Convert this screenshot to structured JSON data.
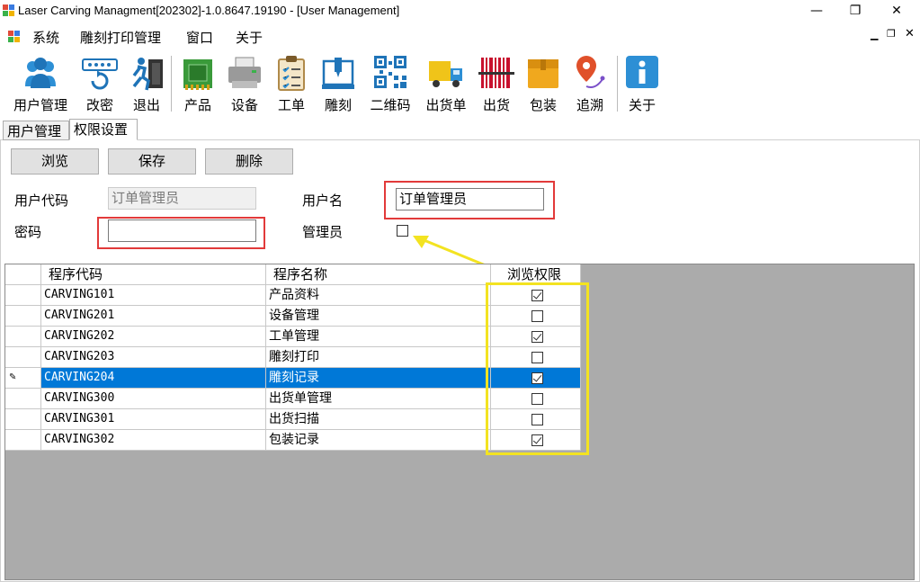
{
  "window": {
    "title": "Laser Carving Managment[202302]-1.0.8647.19190 - [User Management]",
    "minimize": "—",
    "maximize": "❐",
    "close": "✕"
  },
  "menu": {
    "items": [
      "系统",
      "雕刻打印管理",
      "窗口",
      "关于"
    ]
  },
  "toolbar": {
    "buttons": [
      {
        "label": "用户管理",
        "icon": "users-icon"
      },
      {
        "label": "改密",
        "icon": "password-icon"
      },
      {
        "label": "退出",
        "icon": "exit-icon"
      },
      {
        "label": "产品",
        "icon": "chip-icon"
      },
      {
        "label": "设备",
        "icon": "printer-icon"
      },
      {
        "label": "工单",
        "icon": "clipboard-icon"
      },
      {
        "label": "雕刻",
        "icon": "engraver-icon"
      },
      {
        "label": "二维码",
        "icon": "qrcode-icon"
      },
      {
        "label": "出货单",
        "icon": "truck-icon"
      },
      {
        "label": "出货",
        "icon": "barcode-icon"
      },
      {
        "label": "包装",
        "icon": "box-icon"
      },
      {
        "label": "追溯",
        "icon": "location-icon"
      },
      {
        "label": "关于",
        "icon": "info-icon"
      }
    ]
  },
  "tabs": [
    "用户管理",
    "权限设置"
  ],
  "actions": {
    "browse": "浏览",
    "save": "保存",
    "delete": "删除"
  },
  "form": {
    "user_code_label": "用户代码",
    "user_code_value": "订单管理员",
    "user_name_label": "用户名",
    "user_name_value": "订单管理员",
    "password_label": "密码",
    "password_value": "",
    "admin_label": "管理员",
    "admin_checked": false
  },
  "grid": {
    "columns": [
      "程序代码",
      "程序名称",
      "浏览权限"
    ],
    "rows": [
      {
        "code": "CARVING101",
        "name": "产品资料",
        "browse": true
      },
      {
        "code": "CARVING201",
        "name": "设备管理",
        "browse": false
      },
      {
        "code": "CARVING202",
        "name": "工单管理",
        "browse": true
      },
      {
        "code": "CARVING203",
        "name": "雕刻打印",
        "browse": false
      },
      {
        "code": "CARVING204",
        "name": "雕刻记录",
        "browse": true,
        "selected": true
      },
      {
        "code": "CARVING300",
        "name": "出货单管理",
        "browse": false
      },
      {
        "code": "CARVING301",
        "name": "出货扫描",
        "browse": false
      },
      {
        "code": "CARVING302",
        "name": "包装记录",
        "browse": true
      }
    ]
  },
  "colors": {
    "selection": "#0078d7",
    "highlight_red": "#e23a3a",
    "highlight_yellow": "#f3e321",
    "grid_background": "#ababab"
  }
}
